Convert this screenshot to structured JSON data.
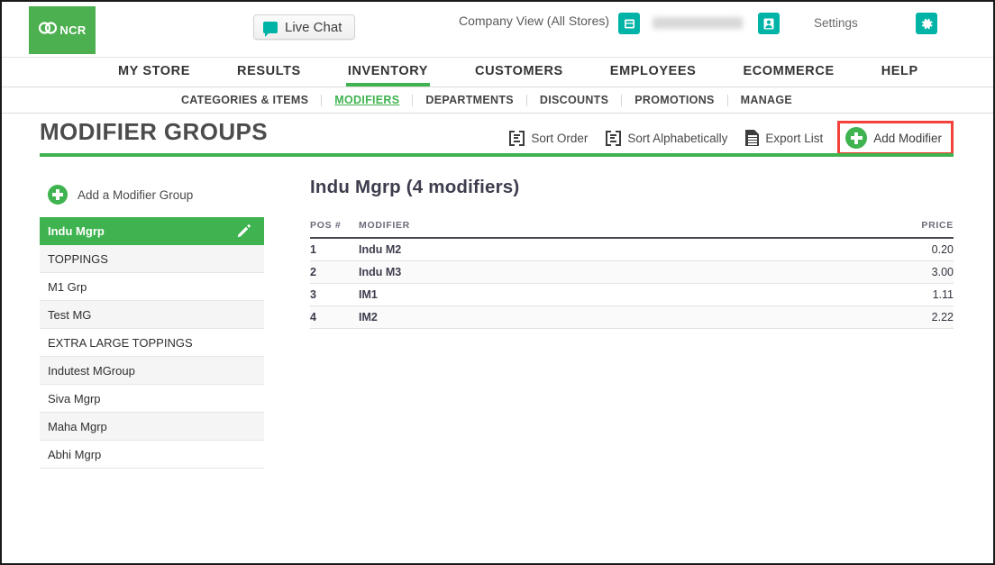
{
  "header": {
    "logo_text": "NCR",
    "logo_icon": "ncr-rings-icon",
    "live_chat_label": "Live Chat",
    "live_chat_icon": "chat-bubble-icon",
    "company_view_label": "Company View (All Stores)",
    "store_icon": "store-icon",
    "user_icon": "user-badge-icon",
    "username_masked": "",
    "settings_label": "Settings",
    "gear_icon": "gear-icon"
  },
  "main_nav": {
    "items": [
      {
        "label": "MY STORE",
        "active": false
      },
      {
        "label": "RESULTS",
        "active": false
      },
      {
        "label": "INVENTORY",
        "active": true
      },
      {
        "label": "CUSTOMERS",
        "active": false
      },
      {
        "label": "EMPLOYEES",
        "active": false
      },
      {
        "label": "ECOMMERCE",
        "active": false
      },
      {
        "label": "HELP",
        "active": false
      }
    ]
  },
  "sub_nav": {
    "items": [
      {
        "label": "CATEGORIES & ITEMS",
        "active": false
      },
      {
        "label": "MODIFIERS",
        "active": true
      },
      {
        "label": "DEPARTMENTS",
        "active": false
      },
      {
        "label": "DISCOUNTS",
        "active": false
      },
      {
        "label": "PROMOTIONS",
        "active": false
      },
      {
        "label": "MANAGE",
        "active": false
      }
    ]
  },
  "page": {
    "title": "MODIFIER GROUPS",
    "toolbar": {
      "sort_order_label": "Sort Order",
      "sort_order_icon": "sort-order-icon",
      "sort_alphabetically_label": "Sort Alphabetically",
      "sort_alphabetically_icon": "sort-alphabetical-icon",
      "export_list_label": "Export List",
      "export_list_icon": "document-export-icon",
      "add_modifier_label": "Add Modifier",
      "add_modifier_icon": "plus-circle-icon",
      "add_modifier_highlight_color": "#f4413c"
    },
    "accent_color": "#3fb34f",
    "teal_color": "#00b3a7"
  },
  "sidebar": {
    "add_group_label": "Add a Modifier Group",
    "add_group_icon": "plus-circle-icon",
    "edit_icon": "pencil-icon",
    "groups": [
      {
        "label": "Indu Mgrp",
        "selected": true
      },
      {
        "label": "TOPPINGS",
        "selected": false
      },
      {
        "label": "M1 Grp",
        "selected": false
      },
      {
        "label": "Test MG",
        "selected": false
      },
      {
        "label": "EXTRA LARGE TOPPINGS",
        "selected": false
      },
      {
        "label": "Indutest MGroup",
        "selected": false
      },
      {
        "label": "Siva Mgrp",
        "selected": false
      },
      {
        "label": "Maha Mgrp",
        "selected": false
      },
      {
        "label": "Abhi Mgrp",
        "selected": false
      }
    ]
  },
  "content": {
    "heading": "Indu Mgrp (4 modifiers)",
    "table": {
      "columns": [
        "POS #",
        "MODIFIER",
        "PRICE"
      ],
      "rows": [
        {
          "pos": "1",
          "modifier": "Indu M2",
          "price": "0.20"
        },
        {
          "pos": "2",
          "modifier": "Indu M3",
          "price": "3.00"
        },
        {
          "pos": "3",
          "modifier": "IM1",
          "price": "1.11"
        },
        {
          "pos": "4",
          "modifier": "IM2",
          "price": "2.22"
        }
      ]
    }
  }
}
